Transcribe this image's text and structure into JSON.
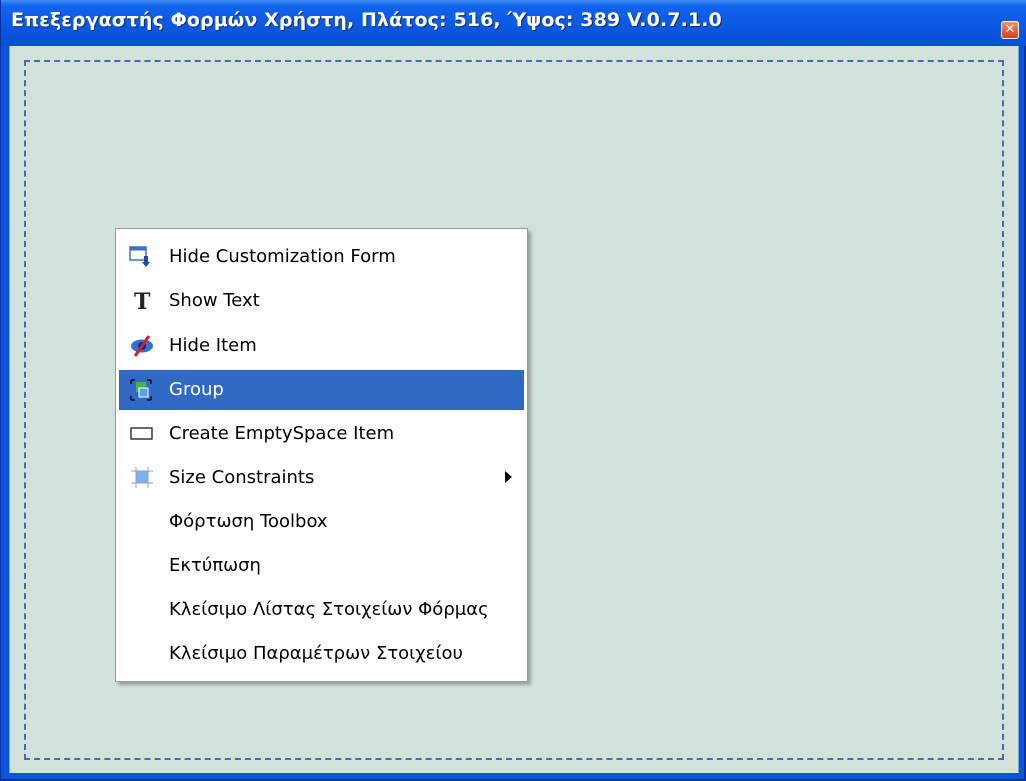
{
  "window": {
    "title": "Επεξεργαστής Φορμών Χρήστη, Πλάτος: 516, Ύψος: 389 V.0.7.1.0",
    "close_glyph": "✕"
  },
  "context_menu": {
    "items": [
      {
        "label": "Hide Customization Form",
        "icon": "hide-customization-form-icon"
      },
      {
        "label": "Show Text",
        "icon": "show-text-icon"
      },
      {
        "label": "Hide Item",
        "icon": "hide-item-icon"
      },
      {
        "label": "Group",
        "icon": "group-icon",
        "highlighted": true
      },
      {
        "label": "Create EmptySpace Item",
        "icon": "empty-space-icon"
      },
      {
        "label": "Size Constraints",
        "icon": "size-constraints-icon",
        "submenu": true
      },
      {
        "label": "Φόρτωση Toolbox"
      },
      {
        "label": "Εκτύπωση"
      },
      {
        "label": "Κλείσιμο Λίστας Στοιχείων Φόρμας"
      },
      {
        "label": "Κλείσιμο Παραμέτρων Στοιχείου"
      }
    ]
  },
  "colors": {
    "titlebar": "#0a56d8",
    "client_background": "#d2e1da",
    "menu_highlight": "#316ac5",
    "close_button": "#d4401a"
  }
}
